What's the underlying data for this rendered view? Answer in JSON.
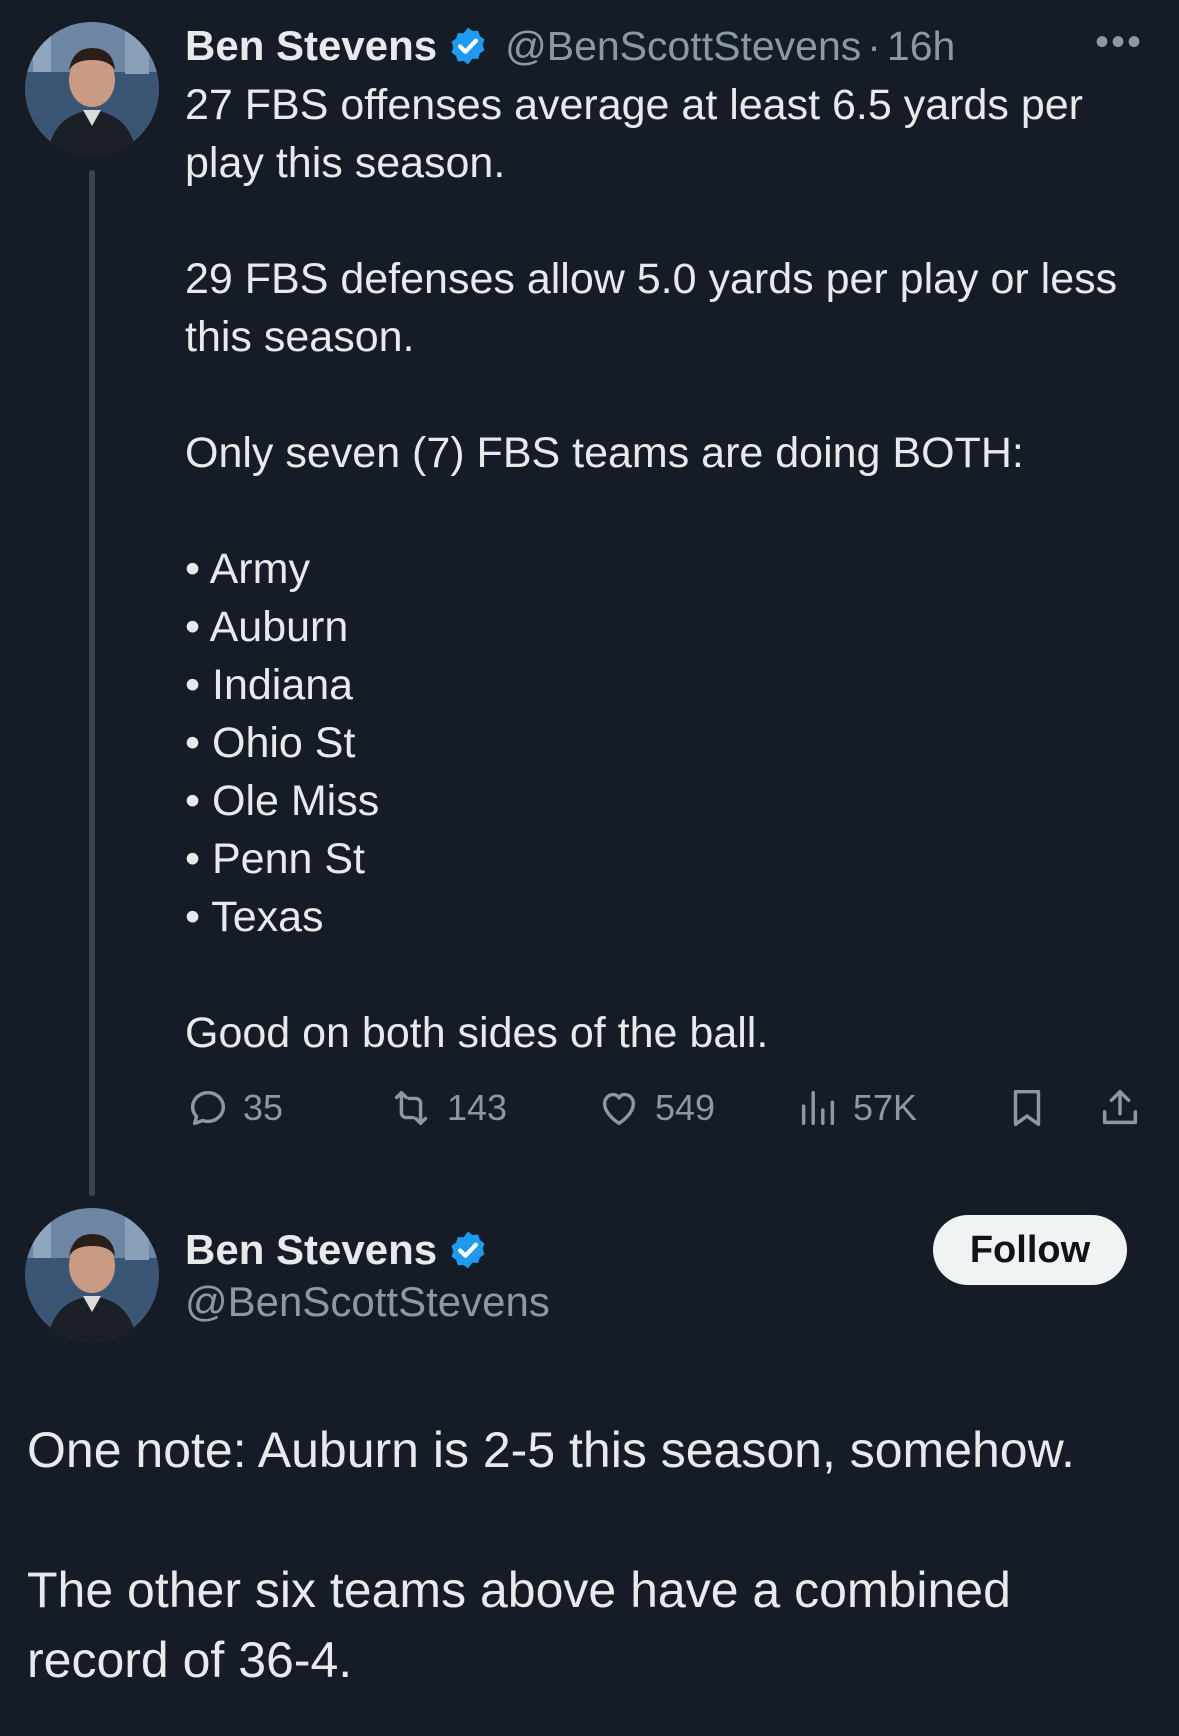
{
  "tweet": {
    "author": {
      "display_name": "Ben Stevens",
      "handle": "@BenScottStevens",
      "time": "16h",
      "separator": "·",
      "verified_color": "#1d9bf0"
    },
    "more_label": "•••",
    "text": {
      "p1": "27 FBS offenses average at least 6.5 yards per play this season.",
      "p2": "29 FBS defenses allow 5.0 yards per play or less this season.",
      "p3": "Only seven (7) FBS teams are doing BOTH:",
      "teams": [
        "• Army",
        "• Auburn",
        "• Indiana",
        "• Ohio St",
        "• Ole Miss",
        "• Penn St",
        "• Texas"
      ],
      "p4": "Good on both sides of the ball."
    },
    "actions": {
      "replies": "35",
      "retweets": "143",
      "likes": "549",
      "views": "57K",
      "icons": [
        "reply-icon",
        "retweet-icon",
        "like-icon",
        "views-icon",
        "bookmark-icon",
        "share-icon"
      ]
    }
  },
  "reply": {
    "author": {
      "display_name": "Ben Stevens",
      "handle": "@BenScottStevens"
    },
    "follow_label": "Follow",
    "text": {
      "p1": "One note: Auburn is 2-5 this season, somehow.",
      "p2": "The other six teams above have a combined record of 36-4."
    }
  },
  "colors": {
    "background": "#151c25",
    "text": "#e7e9ea",
    "secondary": "#8b98a5",
    "accent": "#1d9bf0",
    "follow_button": "#eff3f4"
  }
}
